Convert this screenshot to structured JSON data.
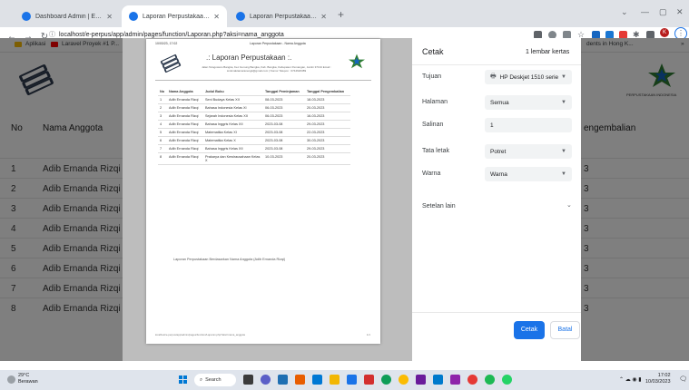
{
  "browser": {
    "tabs": [
      {
        "title": "Dashboard Admin | E - Perpus SMK",
        "active": false
      },
      {
        "title": "Laporan Perpustakaan - Nama Anggota",
        "active": true
      },
      {
        "title": "Laporan Perpustakaan - Tanggal",
        "active": false
      }
    ],
    "new_tab": "+",
    "url": "localhost/e-perpus/app/admin/pages/function/Laporan.php?aksi=nama_anggota",
    "bookmarks": [
      "Aplikasi",
      "Laravel Proyek #1 P..."
    ],
    "avatar_letter": "K",
    "partial_tab_text": "dents in Hong K..."
  },
  "background_page": {
    "table_headers": [
      "No",
      "Nama Anggota",
      "engembalian"
    ],
    "rows": [
      {
        "no": "1",
        "name": "Adib Ernanda Rizqi",
        "suffix": "3"
      },
      {
        "no": "2",
        "name": "Adib Ernanda Rizqi",
        "suffix": "3"
      },
      {
        "no": "3",
        "name": "Adib Ernanda Rizqi",
        "suffix": "3"
      },
      {
        "no": "4",
        "name": "Adib Ernanda Rizqi",
        "suffix": "3"
      },
      {
        "no": "5",
        "name": "Adib Ernanda Rizqi",
        "suffix": "3"
      },
      {
        "no": "6",
        "name": "Adib Ernanda Rizqi",
        "suffix": "3"
      },
      {
        "no": "7",
        "name": "Adib Ernanda Rizqi",
        "suffix": "3"
      },
      {
        "no": "8",
        "name": "Adib Ernanda Rizqi",
        "suffix": "3"
      }
    ],
    "logo_text": "PERPUSTAKAAN INDONESIA"
  },
  "preview": {
    "header_date": "10/03/23, 17:02",
    "header_title": "Laporan Perpustakaan - Nama Anggota",
    "heading": ".: Laporan Perpustakaan :.",
    "address": "Jalan Telogowaru Bangka, Kec Gunung Bangka, Kab. Bangka, Kabupaten Pemangan, Jambi 37134 Email : smkmaktamaranengk@gmail.com | Nomor Telepon : 0744620389",
    "columns": [
      "No",
      "Nama Anggota",
      "Judul Buku",
      "Tanggal Peminjaman",
      "Tanggal Pengembalian"
    ],
    "rows": [
      [
        "1",
        "Adib Ernanda Rizqi",
        "Seni Budaya Kelas XII",
        "08-03-2023",
        "18-03-2023"
      ],
      [
        "2",
        "Adib Ernanda Rizqi",
        "Bahasa Indonesia Kelas XI",
        "06-03-2023",
        "20-03-2023"
      ],
      [
        "3",
        "Adib Ernanda Rizqi",
        "Sejarah Indonesia Kelas XII",
        "06-03-2023",
        "16-03-2023"
      ],
      [
        "4",
        "Adib Ernanda Rizqi",
        "Bahasa Inggris Kelas XII",
        "2023-03-08",
        "29-03-2023"
      ],
      [
        "5",
        "Adib Ernanda Rizqi",
        "Matematika Kelas XI",
        "2023-03-08",
        "22-03-2023"
      ],
      [
        "6",
        "Adib Ernanda Rizqi",
        "Matematika Kelas X",
        "2023-03-08",
        "30-03-2023"
      ],
      [
        "7",
        "Adib Ernanda Rizqi",
        "Bahasa Inggris Kelas XII",
        "2023-03-08",
        "29-03-2023"
      ],
      [
        "8",
        "Adib Ernanda Rizqi",
        "Prakarya dan Kewirausahaan Kelas X",
        "10-03-2023",
        "20-03-2023"
      ]
    ],
    "caption": "Laporan Perpustakaan Berdasarkan Nama Anggota (Adib Ernanda Rizqi)",
    "footer_url": "localhost/e-perpus/app/admin/pages/function/Laporan.php?aksi=nama_anggota",
    "footer_page": "1/1"
  },
  "print_dialog": {
    "title": "Cetak",
    "sheets": "1 lembar kertas",
    "fields": [
      {
        "label": "Tujuan",
        "value": "HP Deskjet 1510 serie",
        "type": "select"
      },
      {
        "label": "Halaman",
        "value": "Semua",
        "type": "select"
      },
      {
        "label": "Salinan",
        "value": "1",
        "type": "input"
      },
      {
        "label": "Tata letak",
        "value": "Potret",
        "type": "select"
      },
      {
        "label": "Warna",
        "value": "Warna",
        "type": "select"
      }
    ],
    "more_settings": "Setelan lain",
    "print_button": "Cetak",
    "cancel_button": "Batal"
  },
  "taskbar": {
    "temperature": "29°C",
    "weather": "Berawan",
    "search": "Search",
    "time": "17:02",
    "date": "10/03/2023"
  },
  "colors": {
    "accent": "#1a73e8",
    "overlay": "#7f7f7f",
    "taskbar": "#dfe4ec"
  }
}
